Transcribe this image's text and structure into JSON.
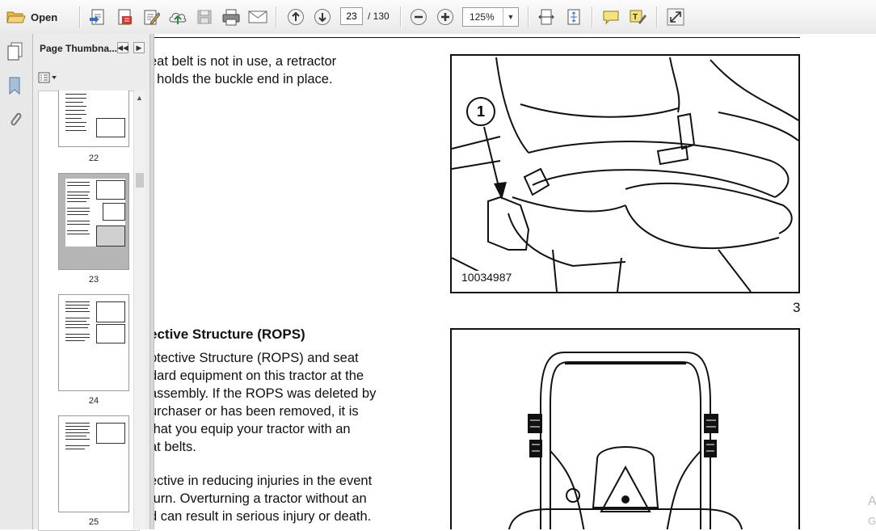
{
  "toolbar": {
    "open_label": "Open",
    "current_page": "23",
    "page_total": "/ 130",
    "zoom": "125%"
  },
  "panel": {
    "title": "Page Thumbna...",
    "thumbnails": [
      {
        "label": "22"
      },
      {
        "label": "23"
      },
      {
        "label": "24"
      },
      {
        "label": "25"
      }
    ]
  },
  "document": {
    "para1_lines": [
      "eat  belt  is  not  in  use,  a  retractor",
      ", holds the buckle end in place."
    ],
    "heading": "ective Structure (ROPS)",
    "para2_lines": [
      "otective  Structure  (ROPS)  and  seat",
      "dard equipment on this tractor at the",
      "assembly. If the ROPS was deleted by",
      "urchaser  or  has  been  removed,  it  is",
      "   that you equip your tractor with an",
      "at belts."
    ],
    "para3_lines": [
      "ective in reducing injuries in the event",
      "turn.  Overturning a tractor without an",
      "d can result in serious injury or death."
    ],
    "figure1_code": "10034987",
    "figure1_callout": "1",
    "figure1_number": "3",
    "watermark_lines": [
      "A",
      "G"
    ]
  },
  "colors": {
    "accent_blue": "#1a5fb4",
    "selected_thumb": "#b5b5b5"
  }
}
